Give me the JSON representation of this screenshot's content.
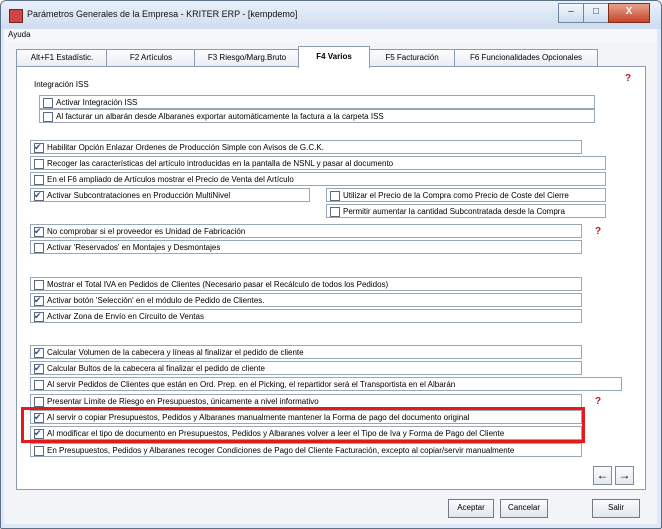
{
  "window": {
    "title": "Parámetros Generales de la Empresa - KRITER ERP - [kempdemo]",
    "controls": {
      "minimize": "–",
      "maximize": "□",
      "close": "X"
    }
  },
  "menubar": {
    "items": [
      "Ayuda"
    ]
  },
  "tabs": [
    {
      "label": "Alt+F1 Estadístic."
    },
    {
      "label": "F2 Artículos"
    },
    {
      "label": "F3 Riesgo/Marg.Bruto"
    },
    {
      "label": "F4 Varios"
    },
    {
      "label": "F5 Facturación"
    },
    {
      "label": "F6 Funcionalidades Opcionales"
    }
  ],
  "active_tab": "F4 Varios",
  "group_iss": {
    "title": "Integración ISS",
    "options": [
      {
        "label": "Activar Integración ISS",
        "checked": false
      },
      {
        "label": "Al facturar un albarán desde Albaranes exportar automáticamente la factura a la carpeta ISS",
        "checked": false
      }
    ]
  },
  "options": [
    {
      "label": "Habilitar Opción Enlazar Ordenes de Producción Simple con Avisos de G.C.K.",
      "checked": true
    },
    {
      "label": "Recoger las características del artículo introducidas en la pantalla de NSNL y pasar al documento",
      "checked": false
    },
    {
      "label": "En el F6 ampliado de Artículos mostrar el Precio de Venta del Artículo",
      "checked": false
    },
    {
      "label": "Activar Subcontrataciones en Producción MultiNivel",
      "checked": true
    },
    {
      "label": "Utilizar el Precio de la Compra como Precio de Coste del Cierre",
      "checked": false
    },
    {
      "label": "Permitir aumentar la cantidad Subcontratada desde la Compra",
      "checked": false
    },
    {
      "label": "No comprobar si el proveedor es Unidad de Fabricación",
      "checked": true
    },
    {
      "label": "Activar 'Reservados' en Montajes y Desmontajes",
      "checked": false
    },
    {
      "label": "Mostrar el Total IVA en Pedidos de Clientes (Necesario pasar el Recálculo de todos los Pedidos)",
      "checked": false
    },
    {
      "label": "Activar botón 'Selección' en el módulo de Pedido de Clientes.",
      "checked": true
    },
    {
      "label": "Activar Zona de Envío en Circuito de Ventas",
      "checked": true
    },
    {
      "label": "Calcular Volumen de la cabecera y líneas al finalizar el pedido de cliente",
      "checked": true
    },
    {
      "label": "Calcular Bultos de la cabecera al finalizar el pedido de cliente",
      "checked": true
    },
    {
      "label": "Al servir Pedidos de Clientes que están en Ord. Prep. en el Picking, el repartidor será el Transportista en el Albarán",
      "checked": false
    },
    {
      "label": "Presentar Límite de Riesgo en Presupuestos, únicamente a nivel informativo",
      "checked": false
    },
    {
      "label": "Al servir o copiar Presupuestos, Pedidos y Albaranes manualmente mantener la Forma de pago del documento original",
      "checked": true
    },
    {
      "label": "Al modificar el tipo de documento en Presupuestos, Pedidos y Albaranes volver a leer el Tipo de Iva y Forma de Pago del Cliente",
      "checked": true
    },
    {
      "label": "En Presupuestos, Pedidos y Albaranes recoger Condiciones de Pago del Cliente Facturación, excepto al copiar/servir manualmente",
      "checked": false
    }
  ],
  "help_icon": "?",
  "nav": {
    "prev": "←",
    "next": "→"
  },
  "buttons": {
    "accept": "Aceptar",
    "cancel": "Cancelar",
    "exit": "Salir"
  },
  "colors": {
    "highlight": "#e21b1b",
    "help_icon": "#c0161b"
  }
}
